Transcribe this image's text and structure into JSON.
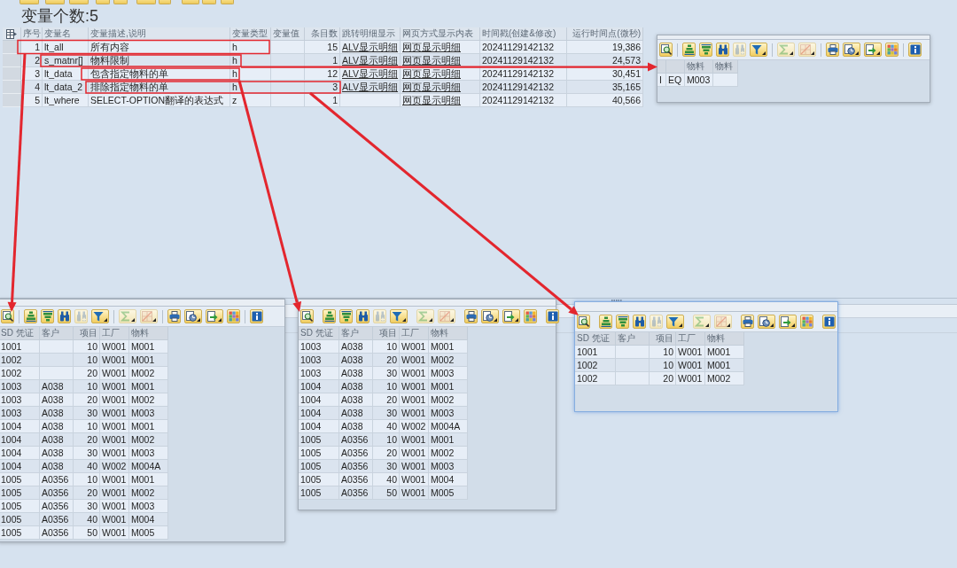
{
  "title": "变量个数:5",
  "variables_table": {
    "columns": [
      {
        "label": "序号",
        "kind": "number"
      },
      {
        "label": "变量名",
        "kind": "text"
      },
      {
        "label": "变量描述,说明",
        "kind": "text"
      },
      {
        "label": "变量类型",
        "kind": "text"
      },
      {
        "label": "变量值",
        "kind": "text"
      },
      {
        "label": "条目数",
        "kind": "number"
      },
      {
        "label": "跳转明细显示",
        "kind": "link"
      },
      {
        "label": "网页方式显示内表",
        "kind": "link"
      },
      {
        "label": "时间戳(创建&修改)",
        "kind": "text"
      },
      {
        "label": "运行时间点(微秒)",
        "kind": "number"
      }
    ],
    "rows": [
      [
        "1",
        "lt_all",
        "所有内容",
        "h",
        null,
        "15",
        "ALV显示明细",
        "网页显示明细",
        "20241129142132",
        "19,386"
      ],
      [
        "2",
        "s_matnr[]",
        "物料限制",
        "h",
        null,
        "1",
        "ALV显示明细",
        "网页显示明细",
        "20241129142132",
        "24,573"
      ],
      [
        "3",
        "lt_data",
        "包含指定物料的单",
        "h",
        null,
        "12",
        "ALV显示明细",
        "网页显示明细",
        "20241129142132",
        "30,451"
      ],
      [
        "4",
        "lt_data_2",
        "排除指定物料的单",
        "h",
        null,
        "3",
        "ALV显示明细",
        "网页显示明细",
        "20241129142132",
        "35,165"
      ],
      [
        "5",
        "lt_where",
        "SELECT-OPTION翻译的表达式",
        "z",
        null,
        "1",
        null,
        "网页显示明细",
        "20241129142132",
        "40,566"
      ]
    ]
  },
  "alv_toolbar": [
    [
      {
        "kind": "details",
        "disabled": false,
        "dropdown": false
      }
    ],
    [
      {
        "kind": "sort_ascending",
        "disabled": false,
        "dropdown": false
      },
      {
        "kind": "sort_descending",
        "disabled": false,
        "dropdown": false
      },
      {
        "kind": "find",
        "disabled": false,
        "dropdown": false
      },
      {
        "kind": "find_next",
        "disabled": true,
        "dropdown": false
      },
      {
        "kind": "filter",
        "disabled": false,
        "dropdown": true
      }
    ],
    [
      {
        "kind": "sum",
        "disabled": true,
        "dropdown": true
      },
      {
        "kind": "subtotal",
        "disabled": true,
        "dropdown": true
      }
    ],
    [
      {
        "kind": "print",
        "disabled": false,
        "dropdown": false
      },
      {
        "kind": "views",
        "disabled": false,
        "dropdown": true
      },
      {
        "kind": "export",
        "disabled": false,
        "dropdown": true
      },
      {
        "kind": "layout",
        "disabled": false,
        "dropdown": false
      }
    ],
    [
      {
        "kind": "info",
        "disabled": false,
        "dropdown": false
      }
    ]
  ],
  "popups": [
    {
      "active": false,
      "columns": [
        {
          "kind": "text"
        },
        {
          "kind": "text"
        },
        {
          "label": "物料",
          "kind": "text"
        },
        {
          "label": "物料",
          "kind": "text"
        }
      ],
      "rows": [
        [
          "I",
          "EQ",
          "M003",
          null
        ]
      ]
    },
    {
      "active": false,
      "columns": [
        {
          "label": "SD 凭证",
          "kind": "text"
        },
        {
          "label": "客户",
          "kind": "text"
        },
        {
          "label": "项目",
          "kind": "number"
        },
        {
          "label": "工厂",
          "kind": "text"
        },
        {
          "label": "物料",
          "kind": "text"
        }
      ],
      "rows": [
        [
          "1001",
          null,
          "10",
          "W001",
          "M001"
        ],
        [
          "1002",
          null,
          "10",
          "W001",
          "M001"
        ],
        [
          "1002",
          null,
          "20",
          "W001",
          "M002"
        ],
        [
          "1003",
          "A038",
          "10",
          "W001",
          "M001"
        ],
        [
          "1003",
          "A038",
          "20",
          "W001",
          "M002"
        ],
        [
          "1003",
          "A038",
          "30",
          "W001",
          "M003"
        ],
        [
          "1004",
          "A038",
          "10",
          "W001",
          "M001"
        ],
        [
          "1004",
          "A038",
          "20",
          "W001",
          "M002"
        ],
        [
          "1004",
          "A038",
          "30",
          "W001",
          "M003"
        ],
        [
          "1004",
          "A038",
          "40",
          "W002",
          "M004A"
        ],
        [
          "1005",
          "A0356",
          "10",
          "W001",
          "M001"
        ],
        [
          "1005",
          "A0356",
          "20",
          "W001",
          "M002"
        ],
        [
          "1005",
          "A0356",
          "30",
          "W001",
          "M003"
        ],
        [
          "1005",
          "A0356",
          "40",
          "W001",
          "M004"
        ],
        [
          "1005",
          "A0356",
          "50",
          "W001",
          "M005"
        ]
      ]
    },
    {
      "active": false,
      "columns": [
        {
          "label": "SD 凭证",
          "kind": "text"
        },
        {
          "label": "客户",
          "kind": "text"
        },
        {
          "label": "项目",
          "kind": "number"
        },
        {
          "label": "工厂",
          "kind": "text"
        },
        {
          "label": "物料",
          "kind": "text"
        }
      ],
      "rows": [
        [
          "1003",
          "A038",
          "10",
          "W001",
          "M001"
        ],
        [
          "1003",
          "A038",
          "20",
          "W001",
          "M002"
        ],
        [
          "1003",
          "A038",
          "30",
          "W001",
          "M003"
        ],
        [
          "1004",
          "A038",
          "10",
          "W001",
          "M001"
        ],
        [
          "1004",
          "A038",
          "20",
          "W001",
          "M002"
        ],
        [
          "1004",
          "A038",
          "30",
          "W001",
          "M003"
        ],
        [
          "1004",
          "A038",
          "40",
          "W002",
          "M004A"
        ],
        [
          "1005",
          "A0356",
          "10",
          "W001",
          "M001"
        ],
        [
          "1005",
          "A0356",
          "20",
          "W001",
          "M002"
        ],
        [
          "1005",
          "A0356",
          "30",
          "W001",
          "M003"
        ],
        [
          "1005",
          "A0356",
          "40",
          "W001",
          "M004"
        ],
        [
          "1005",
          "A0356",
          "50",
          "W001",
          "M005"
        ]
      ]
    },
    {
      "active": true,
      "columns": [
        {
          "label": "SD 凭证",
          "kind": "text"
        },
        {
          "label": "客户",
          "kind": "text"
        },
        {
          "label": "项目",
          "kind": "number"
        },
        {
          "label": "工厂",
          "kind": "text"
        },
        {
          "label": "物料",
          "kind": "text"
        }
      ],
      "rows": [
        [
          "1001",
          null,
          "10",
          "W001",
          "M001"
        ],
        [
          "1002",
          null,
          "10",
          "W001",
          "M001"
        ],
        [
          "1002",
          null,
          "20",
          "W001",
          "M002"
        ]
      ]
    }
  ]
}
